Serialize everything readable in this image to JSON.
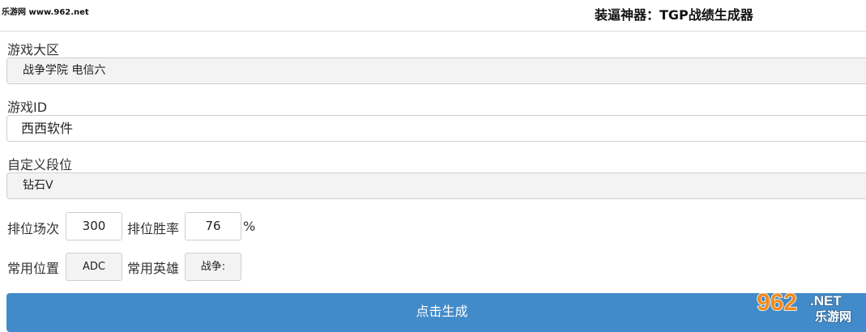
{
  "site_label": "乐游网 www.962.net",
  "page_title": "装逼神器：TGP战绩生成器",
  "form": {
    "region": {
      "label": "游戏大区",
      "value": "战争学院 电信六"
    },
    "game_id": {
      "label": "游戏ID",
      "value": "西西软件"
    },
    "rank": {
      "label": "自定义段位",
      "value": "钻石V"
    },
    "ranked_games": {
      "label": "排位场次",
      "value": "300"
    },
    "win_rate": {
      "label": "排位胜率",
      "value": "76",
      "unit": "%"
    },
    "position": {
      "label": "常用位置",
      "value": "ADC"
    },
    "hero": {
      "label": "常用英雄",
      "value": "战争:"
    }
  },
  "generate_button": "点击生成",
  "watermark": {
    "number": "962",
    "suffix": ".NET",
    "name": "乐游网"
  },
  "colors": {
    "button": "#428bca",
    "watermark_orange": "#f08a1c"
  }
}
